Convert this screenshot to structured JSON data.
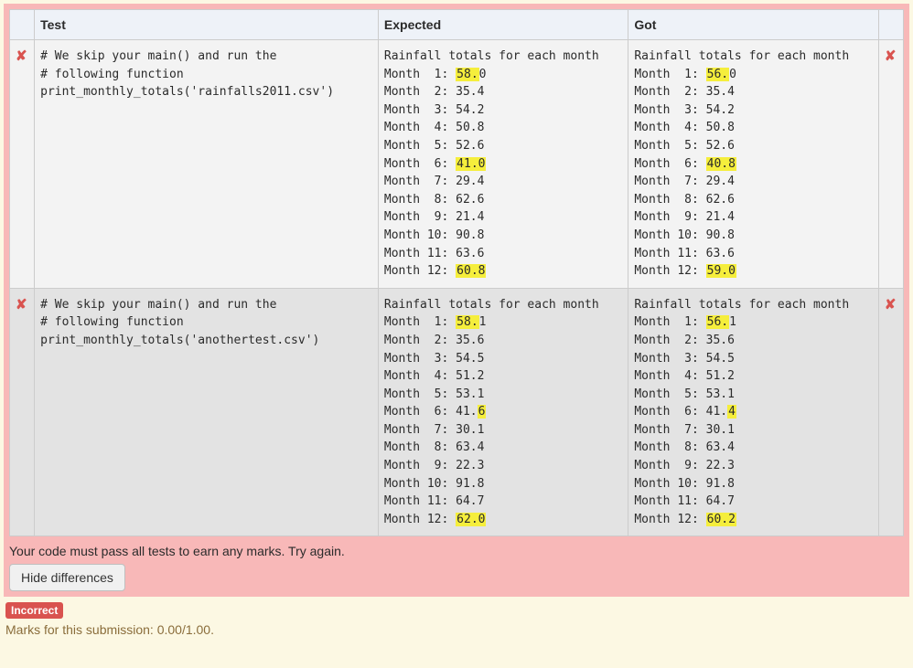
{
  "headers": {
    "test": "Test",
    "expected": "Expected",
    "got": "Got"
  },
  "cross": "✘",
  "tests": [
    {
      "code": "# We skip your main() and run the\n# following function\nprint_monthly_totals('rainfalls2011.csv')",
      "expected_header": "Rainfall totals for each month",
      "got_header": "Rainfall totals for each month",
      "rows": [
        {
          "exp": {
            "pre": "Month  1: ",
            "hl": "58.",
            "post": "0"
          },
          "got": {
            "pre": "Month  1: ",
            "hl": "56.",
            "post": "0"
          }
        },
        {
          "exp": {
            "pre": "Month  2: 35.4",
            "hl": "",
            "post": ""
          },
          "got": {
            "pre": "Month  2: 35.4",
            "hl": "",
            "post": ""
          }
        },
        {
          "exp": {
            "pre": "Month  3: 54.2",
            "hl": "",
            "post": ""
          },
          "got": {
            "pre": "Month  3: 54.2",
            "hl": "",
            "post": ""
          }
        },
        {
          "exp": {
            "pre": "Month  4: 50.8",
            "hl": "",
            "post": ""
          },
          "got": {
            "pre": "Month  4: 50.8",
            "hl": "",
            "post": ""
          }
        },
        {
          "exp": {
            "pre": "Month  5: 52.6",
            "hl": "",
            "post": ""
          },
          "got": {
            "pre": "Month  5: 52.6",
            "hl": "",
            "post": ""
          }
        },
        {
          "exp": {
            "pre": "Month  6: ",
            "hl": "41.0",
            "post": ""
          },
          "got": {
            "pre": "Month  6: ",
            "hl": "40.8",
            "post": ""
          }
        },
        {
          "exp": {
            "pre": "Month  7: 29.4",
            "hl": "",
            "post": ""
          },
          "got": {
            "pre": "Month  7: 29.4",
            "hl": "",
            "post": ""
          }
        },
        {
          "exp": {
            "pre": "Month  8: 62.6",
            "hl": "",
            "post": ""
          },
          "got": {
            "pre": "Month  8: 62.6",
            "hl": "",
            "post": ""
          }
        },
        {
          "exp": {
            "pre": "Month  9: 21.4",
            "hl": "",
            "post": ""
          },
          "got": {
            "pre": "Month  9: 21.4",
            "hl": "",
            "post": ""
          }
        },
        {
          "exp": {
            "pre": "Month 10: 90.8",
            "hl": "",
            "post": ""
          },
          "got": {
            "pre": "Month 10: 90.8",
            "hl": "",
            "post": ""
          }
        },
        {
          "exp": {
            "pre": "Month 11: 63.6",
            "hl": "",
            "post": ""
          },
          "got": {
            "pre": "Month 11: 63.6",
            "hl": "",
            "post": ""
          }
        },
        {
          "exp": {
            "pre": "Month 12: ",
            "hl": "60.8",
            "post": ""
          },
          "got": {
            "pre": "Month 12: ",
            "hl": "59.0",
            "post": ""
          }
        }
      ]
    },
    {
      "code": "# We skip your main() and run the\n# following function\nprint_monthly_totals('anothertest.csv')",
      "expected_header": "Rainfall totals for each month",
      "got_header": "Rainfall totals for each month",
      "rows": [
        {
          "exp": {
            "pre": "Month  1: ",
            "hl": "58.",
            "post": "1"
          },
          "got": {
            "pre": "Month  1: ",
            "hl": "56.",
            "post": "1"
          }
        },
        {
          "exp": {
            "pre": "Month  2: 35.6",
            "hl": "",
            "post": ""
          },
          "got": {
            "pre": "Month  2: 35.6",
            "hl": "",
            "post": ""
          }
        },
        {
          "exp": {
            "pre": "Month  3: 54.5",
            "hl": "",
            "post": ""
          },
          "got": {
            "pre": "Month  3: 54.5",
            "hl": "",
            "post": ""
          }
        },
        {
          "exp": {
            "pre": "Month  4: 51.2",
            "hl": "",
            "post": ""
          },
          "got": {
            "pre": "Month  4: 51.2",
            "hl": "",
            "post": ""
          }
        },
        {
          "exp": {
            "pre": "Month  5: 53.1",
            "hl": "",
            "post": ""
          },
          "got": {
            "pre": "Month  5: 53.1",
            "hl": "",
            "post": ""
          }
        },
        {
          "exp": {
            "pre": "Month  6: 41.",
            "hl": "6",
            "post": ""
          },
          "got": {
            "pre": "Month  6: 41.",
            "hl": "4",
            "post": ""
          }
        },
        {
          "exp": {
            "pre": "Month  7: 30.1",
            "hl": "",
            "post": ""
          },
          "got": {
            "pre": "Month  7: 30.1",
            "hl": "",
            "post": ""
          }
        },
        {
          "exp": {
            "pre": "Month  8: 63.4",
            "hl": "",
            "post": ""
          },
          "got": {
            "pre": "Month  8: 63.4",
            "hl": "",
            "post": ""
          }
        },
        {
          "exp": {
            "pre": "Month  9: 22.3",
            "hl": "",
            "post": ""
          },
          "got": {
            "pre": "Month  9: 22.3",
            "hl": "",
            "post": ""
          }
        },
        {
          "exp": {
            "pre": "Month 10: 91.8",
            "hl": "",
            "post": ""
          },
          "got": {
            "pre": "Month 10: 91.8",
            "hl": "",
            "post": ""
          }
        },
        {
          "exp": {
            "pre": "Month 11: 64.7",
            "hl": "",
            "post": ""
          },
          "got": {
            "pre": "Month 11: 64.7",
            "hl": "",
            "post": ""
          }
        },
        {
          "exp": {
            "pre": "Month 12: ",
            "hl": "62.0",
            "post": ""
          },
          "got": {
            "pre": "Month 12: ",
            "hl": "60.2",
            "post": ""
          }
        }
      ]
    }
  ],
  "fail_message": "Your code must pass all tests to earn any marks. Try again.",
  "toggle_label": "Hide differences",
  "status_badge": "Incorrect",
  "marks_text": "Marks for this submission: 0.00/1.00."
}
